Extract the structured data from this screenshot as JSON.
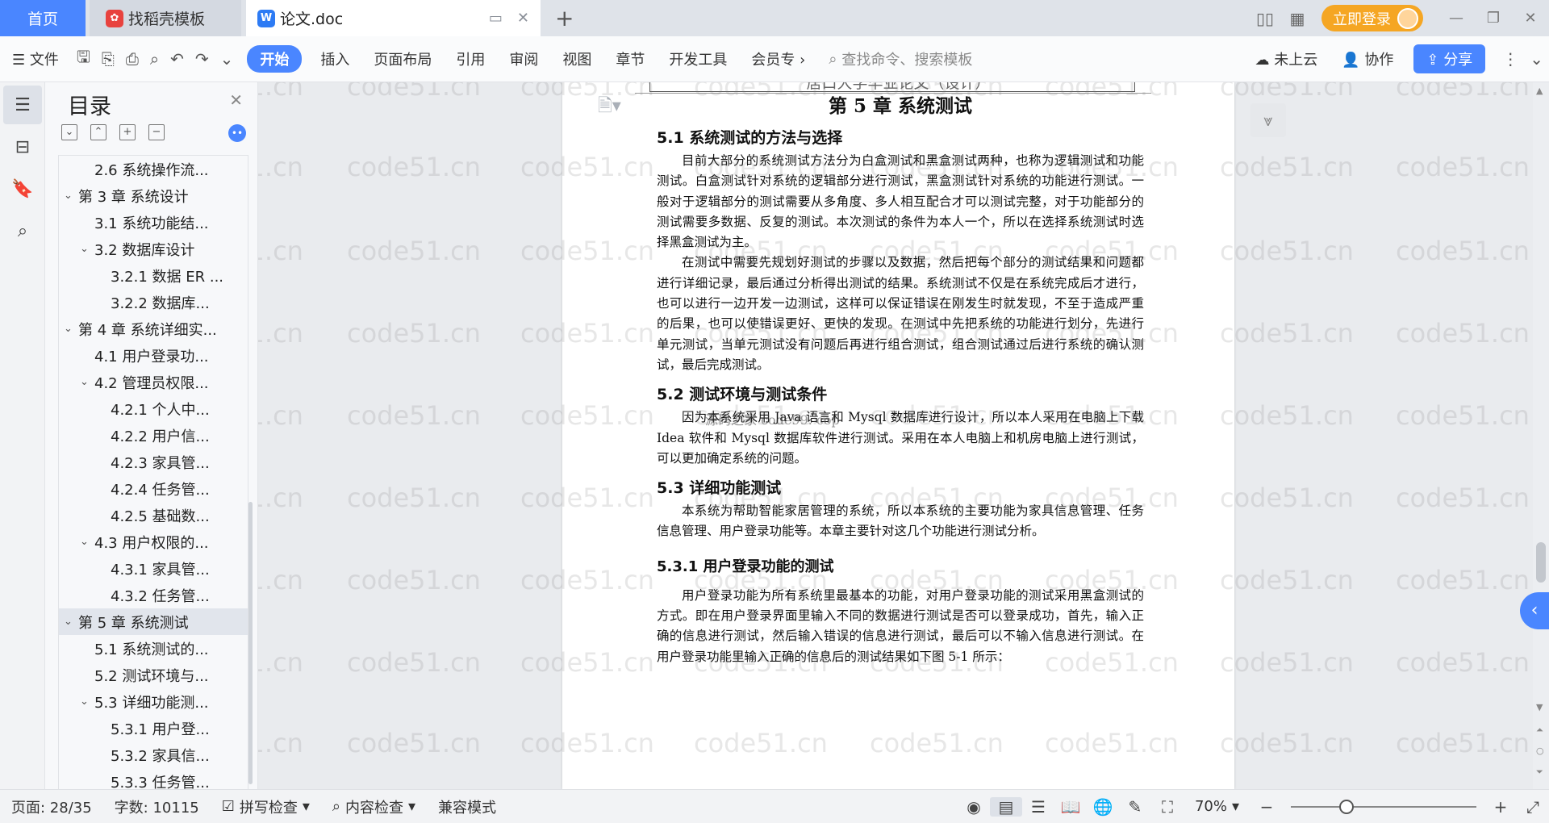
{
  "titlebar": {
    "tabs": {
      "home": "首页",
      "template": "找稻壳模板",
      "doc": "论文.doc"
    },
    "login": "立即登录"
  },
  "ribbon": {
    "file": "文件",
    "start": "开始",
    "insert": "插入",
    "layout": "页面布局",
    "references": "引用",
    "review": "审阅",
    "view": "视图",
    "chapter": "章节",
    "dev": "开发工具",
    "member": "会员专",
    "search_placeholder": "查找命令、搜索模板",
    "cloud": "未上云",
    "collab": "协作",
    "share": "分享"
  },
  "toc": {
    "title": "目录",
    "items": [
      {
        "label": "2.6 系统操作流...",
        "level": 2,
        "arrow": ""
      },
      {
        "label": "第 3 章  系统设计",
        "level": 1,
        "arrow": "v"
      },
      {
        "label": "3.1 系统功能结...",
        "level": 2,
        "arrow": ""
      },
      {
        "label": "3.2 数据库设计",
        "level": 2,
        "arrow": "v"
      },
      {
        "label": "3.2.1 数据 ER ...",
        "level": 3,
        "arrow": ""
      },
      {
        "label": "3.2.2 数据库...",
        "level": 3,
        "arrow": ""
      },
      {
        "label": "第 4 章  系统详细实...",
        "level": 1,
        "arrow": "v"
      },
      {
        "label": "4.1 用户登录功...",
        "level": 2,
        "arrow": ""
      },
      {
        "label": "4.2 管理员权限...",
        "level": 2,
        "arrow": "v"
      },
      {
        "label": "4.2.1 个人中...",
        "level": 3,
        "arrow": ""
      },
      {
        "label": "4.2.2 用户信...",
        "level": 3,
        "arrow": ""
      },
      {
        "label": "4.2.3 家具管...",
        "level": 3,
        "arrow": ""
      },
      {
        "label": "4.2.4 任务管...",
        "level": 3,
        "arrow": ""
      },
      {
        "label": "4.2.5 基础数...",
        "level": 3,
        "arrow": ""
      },
      {
        "label": "4.3 用户权限的...",
        "level": 2,
        "arrow": "v"
      },
      {
        "label": "4.3.1 家具管...",
        "level": 3,
        "arrow": ""
      },
      {
        "label": "4.3.2 任务管...",
        "level": 3,
        "arrow": ""
      },
      {
        "label": "第 5 章  系统测试",
        "level": 1,
        "arrow": "v",
        "selected": true
      },
      {
        "label": "5.1 系统测试的...",
        "level": 2,
        "arrow": ""
      },
      {
        "label": "5.2 测试环境与...",
        "level": 2,
        "arrow": ""
      },
      {
        "label": "5.3 详细功能测...",
        "level": 2,
        "arrow": "v"
      },
      {
        "label": "5.3.1 用户登...",
        "level": 3,
        "arrow": ""
      },
      {
        "label": "5.3.2 家具信...",
        "level": 3,
        "arrow": ""
      },
      {
        "label": "5.3.3 任务管...",
        "level": 3,
        "arrow": ""
      }
    ]
  },
  "document": {
    "header_text": "居口大学毕业论文（设计）",
    "chapter_title": "第 5 章  系统测试",
    "s51_title": "5.1 系统测试的方法与选择",
    "s51_p1": "目前大部分的系统测试方法分为白盒测试和黑盒测试两种，也称为逻辑测试和功能测试。白盒测试针对系统的逻辑部分进行测试，黑盒测试针对系统的功能进行测试。一般对于逻辑部分的测试需要从多角度、多人相互配合才可以测试完整，对于功能部分的测试需要多数据、反复的测试。本次测试的条件为本人一个，所以在选择系统测试时选择黑盒测试为主。",
    "s51_p2": "在测试中需要先规划好测试的步骤以及数据，然后把每个部分的测试结果和问题都进行详细记录，最后通过分析得出测试的结果。系统测试不仅是在系统完成后才进行，也可以进行一边开发一边测试，这样可以保证错误在刚发生时就发现，不至于造成严重的后果，也可以使错误更好、更快的发现。在测试中先把系统的功能进行划分，先进行单元测试，当单元测试没有问题后再进行组合测试，组合测试通过后进行系统的确认测试，最后完成测试。",
    "s52_title": "5.2 测试环境与测试条件",
    "s52_p1": "因为本系统采用 Java 语言和 Mysql 数据库进行设计，所以本人采用在电脑上下载 Idea 软件和 Mysql 数据库软件进行测试。采用在本人电脑上和机房电脑上进行测试，可以更加确定系统的问题。",
    "s52_overlay": "源码之家 code99. cop",
    "s53_title": "5.3 详细功能测试",
    "s53_p1": "本系统为帮助智能家居管理的系统，所以本系统的主要功能为家具信息管理、任务信息管理、用户登录功能等。本章主要针对这几个功能进行测试分析。",
    "s531_title": "5.3.1 用户登录功能的测试",
    "s531_p1": "用户登录功能为所有系统里最基本的功能，对用户登录功能的测试采用黑盒测试的方式。即在用户登录界面里输入不同的数据进行测试是否可以登录成功，首先，输入正确的信息进行测试，然后输入错误的信息进行测试，最后可以不输入信息进行测试。在用户登录功能里输入正确的信息后的测试结果如下图 5-1 所示："
  },
  "watermark": "code51.cn",
  "status": {
    "page": "页面: 28/35",
    "words": "字数: 10115",
    "spell": "拼写检查",
    "content_check": "内容检查",
    "compat": "兼容模式",
    "zoom": "70%",
    "zoom_fraction": 0.3
  },
  "colors": {
    "accent": "#4a86ff",
    "login": "#f5a623"
  }
}
